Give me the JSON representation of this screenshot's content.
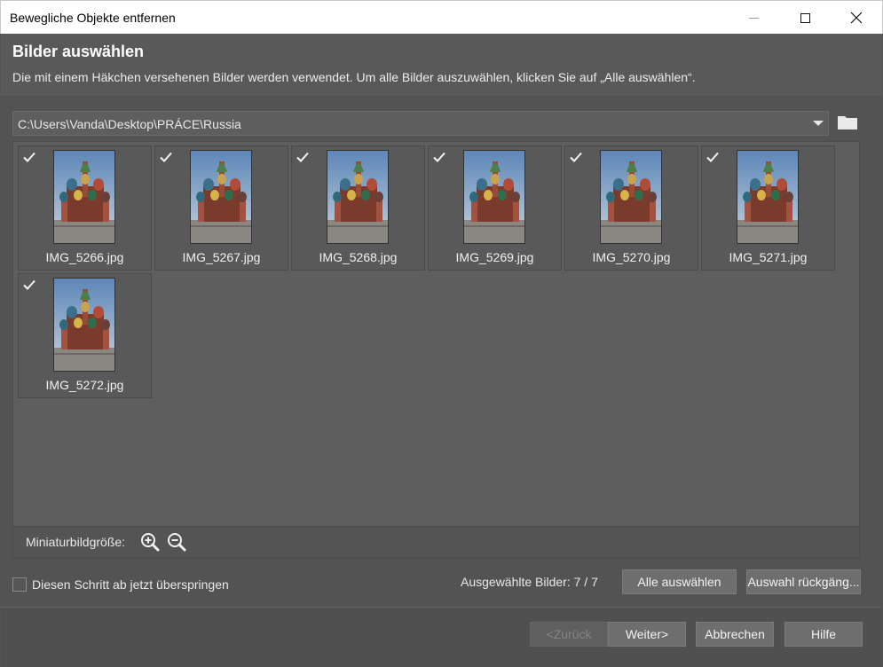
{
  "window": {
    "title": "Bewegliche Objekte entfernen"
  },
  "header": {
    "title": "Bilder auswählen",
    "description": "Die mit einem Häkchen versehenen Bilder werden verwendet. Um alle Bilder auszuwählen, klicken Sie auf „Alle auswählen“."
  },
  "path": {
    "value": "C:\\Users\\Vanda\\Desktop\\PRÁCE\\Russia"
  },
  "thumbnails": [
    {
      "filename": "IMG_5266.jpg",
      "checked": true
    },
    {
      "filename": "IMG_5267.jpg",
      "checked": true
    },
    {
      "filename": "IMG_5268.jpg",
      "checked": true
    },
    {
      "filename": "IMG_5269.jpg",
      "checked": true
    },
    {
      "filename": "IMG_5270.jpg",
      "checked": true
    },
    {
      "filename": "IMG_5271.jpg",
      "checked": true
    },
    {
      "filename": "IMG_5272.jpg",
      "checked": true
    }
  ],
  "zoom": {
    "label": "Miniaturbildgröße:",
    "zoom_in_icon": "zoom-in-icon",
    "zoom_out_icon": "zoom-out-icon"
  },
  "selection": {
    "skip_label": "Diesen Schritt ab jetzt überspringen",
    "skip_checked": false,
    "count_text": "Ausgewählte Bilder: 7 / 7",
    "select_all": "Alle auswählen",
    "deselect": "Auswahl rückgäng..."
  },
  "footer": {
    "back": "<Zurück",
    "next": "Weiter>",
    "cancel": "Abbrechen",
    "help": "Hilfe"
  },
  "colors": {
    "background": "#535353",
    "button": "#6e6e6e",
    "text": "#e8e8e8"
  }
}
